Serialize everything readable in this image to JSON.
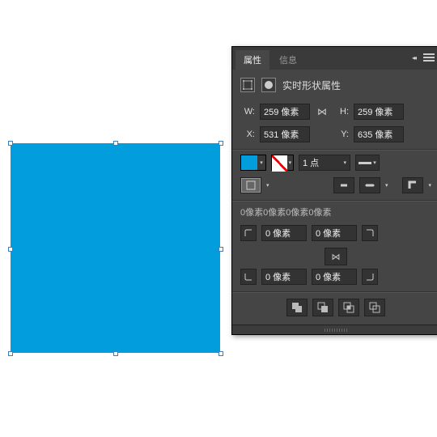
{
  "shape": {
    "fill": "#029ddd"
  },
  "panel": {
    "tabs": {
      "properties": "属性",
      "info": "信息"
    },
    "section_title": "实时形状属性",
    "dims": {
      "w_label": "W:",
      "w_value": "259 像素",
      "h_label": "H:",
      "h_value": "259 像素",
      "x_label": "X:",
      "x_value": "531 像素",
      "y_label": "Y:",
      "y_value": "635 像素"
    },
    "stroke_weight": "1 点",
    "corner_readout": "0像素0像素0像素0像素",
    "corners": {
      "tl": "0 像素",
      "tr": "0 像素",
      "bl": "0 像素",
      "br": "0 像素"
    }
  }
}
